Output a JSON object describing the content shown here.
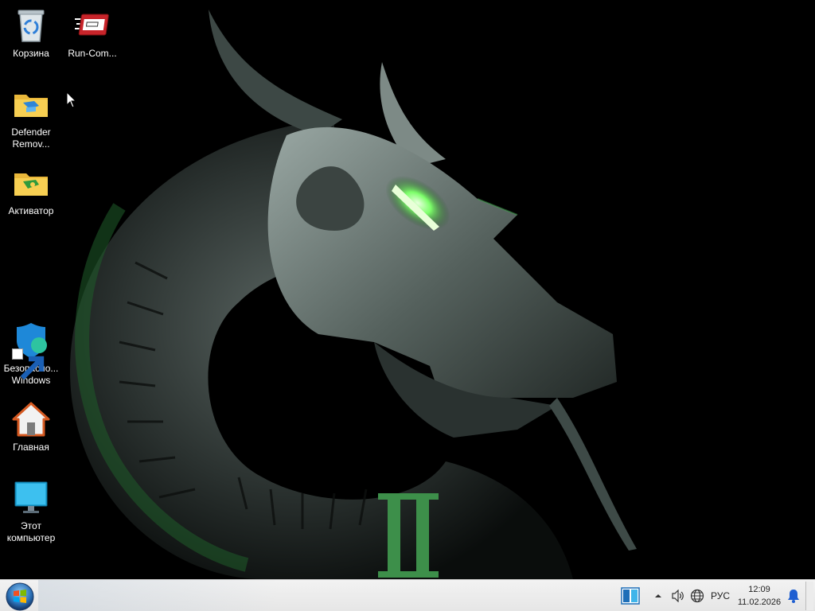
{
  "desktop": {
    "icons": [
      {
        "name": "recycle-bin-icon",
        "label": "Корзина"
      },
      {
        "name": "run-command-icon",
        "label": "Run-Com..."
      },
      {
        "name": "defender-remover-icon",
        "label": "Defender Remov..."
      },
      {
        "name": "activator-icon",
        "label": "Активатор"
      },
      {
        "name": "windows-security-icon",
        "label": "Безопасно... Windows"
      },
      {
        "name": "home-icon",
        "label": "Главная"
      },
      {
        "name": "this-computer-icon",
        "label": "Этот компьютер"
      }
    ],
    "wallpaper_mark": "II"
  },
  "taskbar": {
    "language": "РУС",
    "time": "12:09",
    "date": "11.02.2026"
  },
  "colors": {
    "wallpaper_bg": "#000000",
    "dragon_green": "#3fa34d",
    "eye_glow": "#7dff6a",
    "taskbar_bg": "#ececec",
    "notify_blue": "#1f5fd1"
  }
}
